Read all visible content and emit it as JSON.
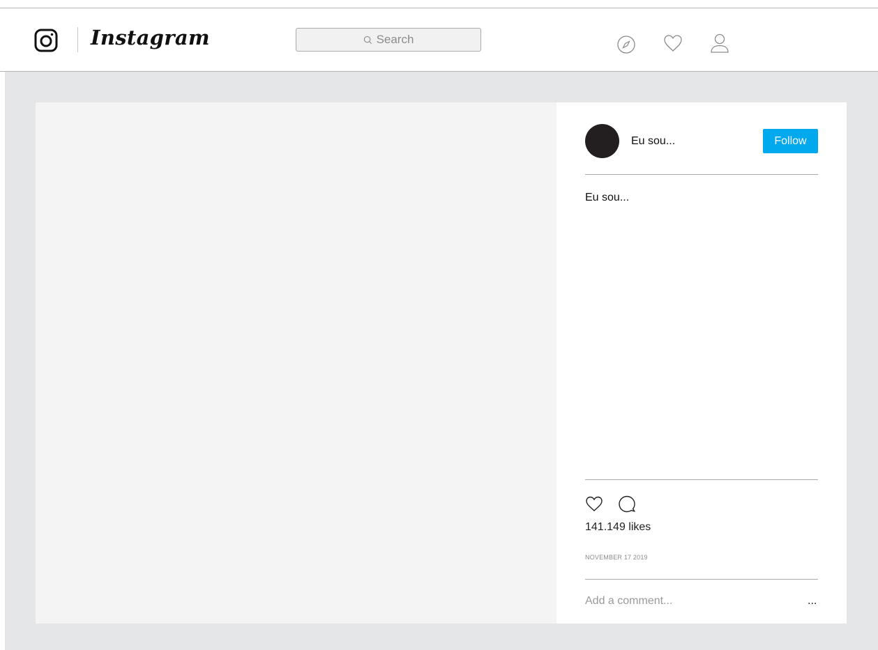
{
  "header": {
    "brand": "Instagram",
    "search": {
      "placeholder": "Search"
    }
  },
  "nav_icons": [
    "compass-icon",
    "heart-icon",
    "profile-icon"
  ],
  "post": {
    "username": "Eu sou...",
    "follow_label": "Follow",
    "caption": "Eu sou...",
    "likes": "141.149 likes",
    "date": "NOVEMBER 17 2019",
    "comment_placeholder": "Add a comment...",
    "more_label": "..."
  },
  "colors": {
    "follow_button": "#00a8ee",
    "page_background": "#e5e6e8",
    "photo_placeholder": "#f4f4f4",
    "avatar": "#231f20"
  }
}
